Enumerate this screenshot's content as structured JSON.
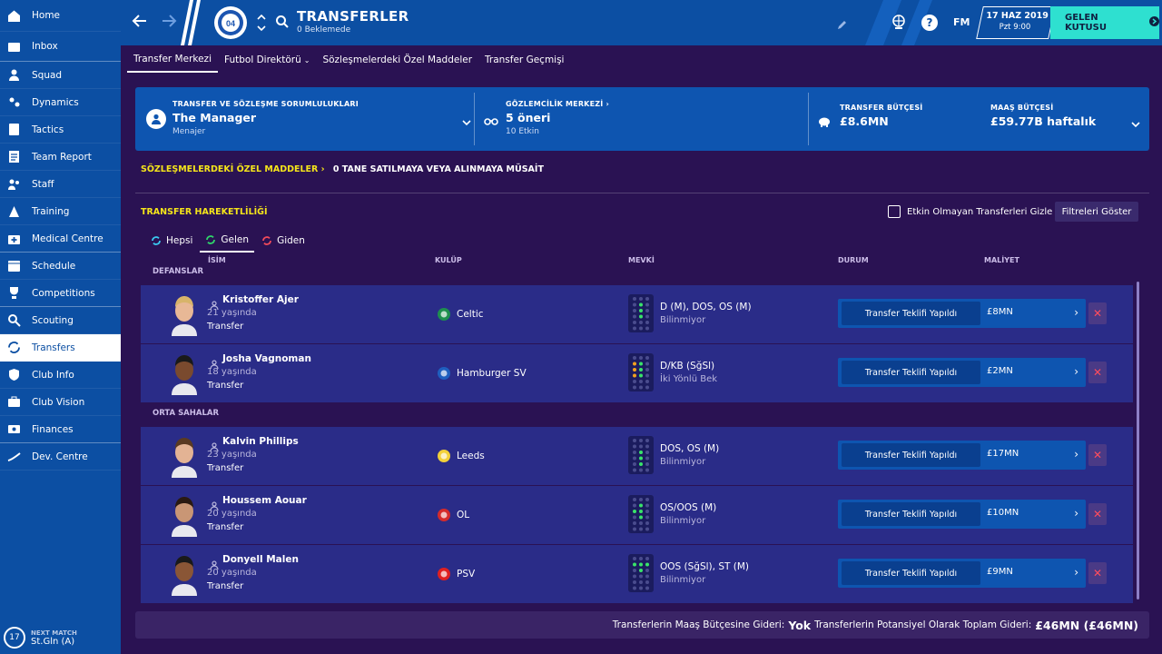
{
  "sidebar": {
    "items": [
      {
        "label": "Home",
        "icon": "home-icon"
      },
      {
        "label": "Inbox",
        "icon": "inbox-icon"
      },
      {
        "label": "Squad",
        "icon": "squad-icon"
      },
      {
        "label": "Dynamics",
        "icon": "dynamics-icon"
      },
      {
        "label": "Tactics",
        "icon": "tactics-icon"
      },
      {
        "label": "Team Report",
        "icon": "report-icon"
      },
      {
        "label": "Staff",
        "icon": "staff-icon"
      },
      {
        "label": "Training",
        "icon": "training-icon"
      },
      {
        "label": "Medical Centre",
        "icon": "medical-icon"
      },
      {
        "label": "Schedule",
        "icon": "calendar-icon"
      },
      {
        "label": "Competitions",
        "icon": "trophy-icon"
      },
      {
        "label": "Scouting",
        "icon": "search-icon"
      },
      {
        "label": "Transfers",
        "icon": "transfer-icon"
      },
      {
        "label": "Club Info",
        "icon": "shield-icon"
      },
      {
        "label": "Club Vision",
        "icon": "briefcase-icon"
      },
      {
        "label": "Finances",
        "icon": "money-icon"
      },
      {
        "label": "Dev. Centre",
        "icon": "dev-icon"
      }
    ],
    "next_match": {
      "label": "NEXT MATCH",
      "value": "St.Gln (A)",
      "day": "17"
    }
  },
  "header": {
    "title": "TRANSFERLER",
    "subtitle": "0 Beklemede",
    "date": "17 HAZ 2019",
    "day_time": "Pzt 9:00",
    "inbox_button": "GELEN KUTUSU",
    "fm_label": "FM",
    "help": "?"
  },
  "tabs": [
    {
      "label": "Transfer Merkezi"
    },
    {
      "label": "Futbol Direktörü"
    },
    {
      "label": "Sözleşmelerdeki Özel Maddeler"
    },
    {
      "label": "Transfer Geçmişi"
    }
  ],
  "responsibilities": {
    "r1_title": "TRANSFER VE SÖZLEŞME SORUMLULUKLARI",
    "r1_value": "The Manager",
    "r1_sub": "Menajer",
    "r2_title": "GÖZLEMCİLİK MERKEZİ",
    "r2_value": "5 öneri",
    "r2_sub": "10 Etkin",
    "r3_title": "TRANSFER BÜTÇESİ",
    "r3_value": "£8.6MN",
    "r4_title": "MAAŞ BÜTÇESİ",
    "r4_value": "£59.77B haftalık"
  },
  "special_clauses": {
    "label": "SÖZLEŞMELERDEKİ ÖZEL MADDELER",
    "value": "0 TANE SATILMAYA VEYA ALINMAYA MÜSAİT"
  },
  "movement": {
    "title": "TRANSFER HAREKETLİLİĞİ",
    "hide_label": "Etkin Olmayan Transferleri Gizle",
    "filter_button": "Filtreleri Göster",
    "subtabs": [
      "Hepsi",
      "Gelen",
      "Giden"
    ]
  },
  "columns": {
    "name": "İSİM",
    "club": "KULÜP",
    "position": "MEVKİ",
    "status": "DURUM",
    "cost": "MALİYET"
  },
  "groups": {
    "defenders": "DEFANSLAR",
    "midfielders": "ORTA SAHALAR"
  },
  "players": [
    {
      "name": "Kristoffer Ajer",
      "age": "21 yaşında",
      "status": "Transfer",
      "club": "Celtic",
      "position": "D (M), DOS, OS (M)",
      "role": "Bilinmiyor",
      "offer": "Transfer Teklifi Yapıldı",
      "cost": "£8MN",
      "crest_color": "#1e8f4e",
      "skin": "#e8b896",
      "hair": "#d8b46a"
    },
    {
      "name": "Josha Vagnoman",
      "age": "18 yaşında",
      "status": "Transfer",
      "club": "Hamburger SV",
      "position": "D/KB (SğSl)",
      "role": "İki Yönlü Bek",
      "offer": "Transfer Teklifi Yapıldı",
      "cost": "£2MN",
      "crest_color": "#1f5fbf",
      "skin": "#7a4a2e",
      "hair": "#1a1a1a"
    },
    {
      "name": "Kalvin Phillips",
      "age": "23 yaşında",
      "status": "Transfer",
      "club": "Leeds",
      "position": "DOS, OS (M)",
      "role": "Bilinmiyor",
      "offer": "Transfer Teklifi Yapıldı",
      "cost": "£17MN",
      "crest_color": "#f2d13a",
      "skin": "#e3b394",
      "hair": "#5a3a22"
    },
    {
      "name": "Houssem Aouar",
      "age": "20 yaşında",
      "status": "Transfer",
      "club": "OL",
      "position": "OS/OOS (M)",
      "role": "Bilinmiyor",
      "offer": "Transfer Teklifi Yapıldı",
      "cost": "£10MN",
      "crest_color": "#d52b2b",
      "skin": "#c99675",
      "hair": "#2a1a12"
    },
    {
      "name": "Donyell Malen",
      "age": "20 yaşında",
      "status": "Transfer",
      "club": "PSV",
      "position": "OOS (SğSl), ST (M)",
      "role": "Bilinmiyor",
      "offer": "Transfer Teklifi Yapıldı",
      "cost": "£9MN",
      "crest_color": "#e02020",
      "skin": "#8a5636",
      "hair": "#1a1a1a"
    }
  ],
  "footer": {
    "wage_label": "Transferlerin Maaş Bütçesine Gideri:",
    "wage_value": "Yok",
    "total_label": "Transferlerin Potansiyel Olarak Toplam Gideri:",
    "total_value": "£46MN (£46MN)"
  }
}
